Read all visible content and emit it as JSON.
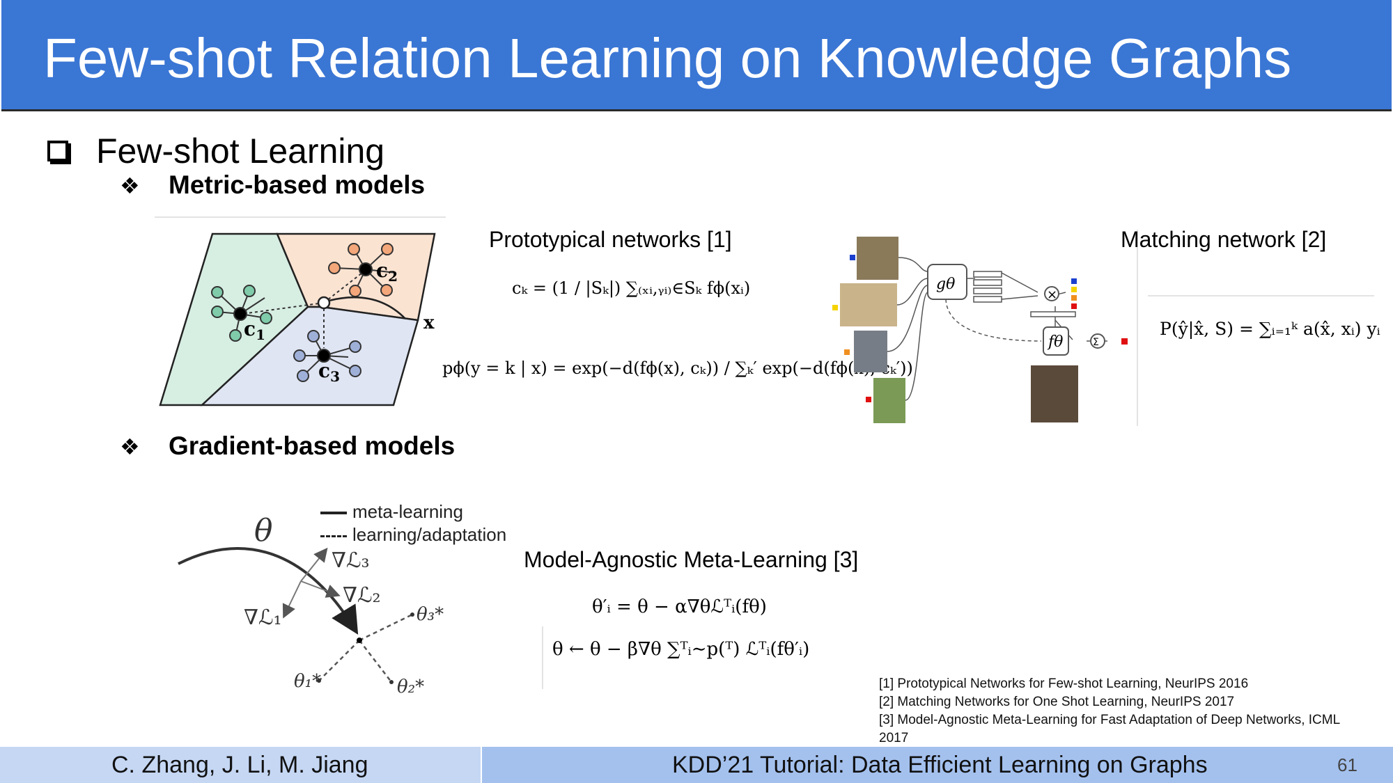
{
  "title": "Few-shot Relation Learning on Knowledge Graphs",
  "bullet": "Few-shot Learning",
  "subheadings": {
    "metric": "Metric-based models",
    "gradient": "Gradient-based models"
  },
  "proto": {
    "label": "Prototypical networks [1]",
    "c1": "c",
    "c1_sub": "1",
    "c2": "c",
    "c2_sub": "2",
    "c3": "c",
    "c3_sub": "3",
    "x": "x",
    "eq1": "cₖ = (1 / |Sₖ|) ∑₍ₓᵢ,ᵧᵢ₎∈Sₖ fϕ(xᵢ)",
    "eq2": "pϕ(y = k | x) = exp(−d(fϕ(x), cₖ)) / ∑ₖ′ exp(−d(fϕ(x), cₖ′))"
  },
  "matching": {
    "label": "Matching network [2]",
    "g": "gθ",
    "f": "fθ",
    "times": "×",
    "sum": "Σ",
    "eq": "P(ŷ|x̂, S) = ∑ᵢ₌₁ᵏ a(x̂, xᵢ) yᵢ"
  },
  "maml": {
    "label": "Model-Agnostic Meta-Learning [3]",
    "legend_solid": "meta-learning",
    "legend_dashed": "learning/adaptation",
    "theta": "θ",
    "g1": "∇ℒ₁",
    "g2": "∇ℒ₂",
    "g3": "∇ℒ₃",
    "t1": "θ₁*",
    "t2": "θ₂*",
    "t3": "θ₃*",
    "eq1": "θ′ᵢ = θ − α∇θℒᵀᵢ(fθ)",
    "eq2": "θ ← θ − β∇θ ∑ᵀᵢ∼p(ᵀ) ℒᵀᵢ(fθ′ᵢ)"
  },
  "references": [
    "[1] Prototypical Networks for Few-shot Learning, NeurIPS 2016",
    "[2] Matching Networks for One Shot Learning, NeurIPS 2017",
    "[3] Model-Agnostic Meta-Learning for Fast Adaptation of Deep Networks, ICML 2017"
  ],
  "footer": {
    "authors": "C. Zhang, J. Li, M. Jiang",
    "event": "KDD’21 Tutorial: Data Efficient Learning on Graphs",
    "page": "61"
  },
  "colors": {
    "title_bar": "#3a76d4",
    "green_region": "#d7eee3",
    "orange_region": "#fbe3d2",
    "blue_region": "#dfe5f3",
    "green_node": "#7fcbaa",
    "orange_node": "#f3a77a",
    "blue_node": "#9fb0d8"
  }
}
